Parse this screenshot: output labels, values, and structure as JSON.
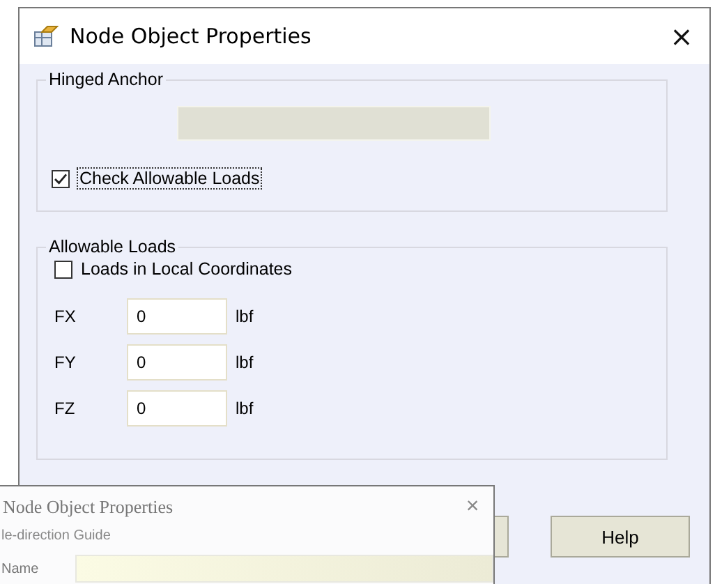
{
  "window": {
    "title": "Node Object Properties",
    "close": "×"
  },
  "hinged_anchor": {
    "title": "Hinged Anchor",
    "field": {
      "disabled": true
    },
    "check_allowable_loads": {
      "label": "Check Allowable Loads",
      "checked": true
    }
  },
  "allowable_loads": {
    "title": "Allowable Loads",
    "local_coordinates": {
      "label": "Loads in Local Coordinates",
      "checked": false
    },
    "rows": [
      {
        "label": "FX",
        "value": "0",
        "unit": "lbf"
      },
      {
        "label": "FY",
        "value": "0",
        "unit": "lbf"
      },
      {
        "label": "FZ",
        "value": "0",
        "unit": "lbf"
      }
    ]
  },
  "buttons": [
    {
      "label": "Help"
    }
  ],
  "overlay_window": {
    "title": "Node Object Properties",
    "close": "×",
    "group": "le-direction Guide",
    "field_label": "Name"
  }
}
